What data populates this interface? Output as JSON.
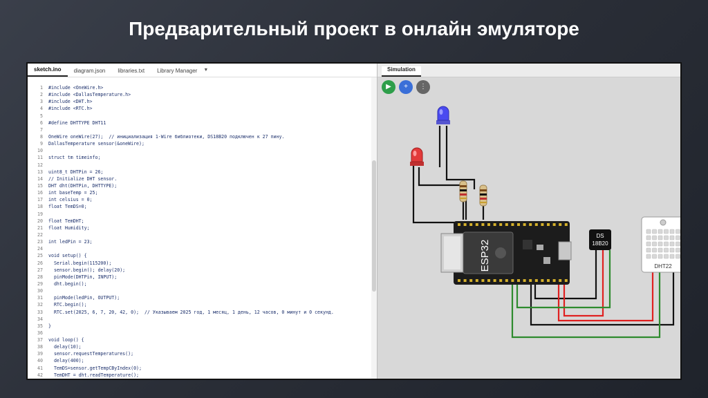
{
  "slide": {
    "title": "Предварительный проект в онлайн эмуляторе"
  },
  "editor": {
    "tabs": [
      {
        "label": "sketch.ino"
      },
      {
        "label": "diagram.json"
      },
      {
        "label": "libraries.txt"
      },
      {
        "label": "Library Manager"
      }
    ],
    "lines": [
      {
        "n": "1",
        "t": "#include <OneWire.h>"
      },
      {
        "n": "2",
        "t": "#include <DallasTemperature.h>"
      },
      {
        "n": "3",
        "t": "#include <DHT.h>"
      },
      {
        "n": "4",
        "t": "#include <RTC.h>"
      },
      {
        "n": "5",
        "t": ""
      },
      {
        "n": "6",
        "t": "#define DHTTYPE DHT11"
      },
      {
        "n": "7",
        "t": ""
      },
      {
        "n": "8",
        "t": "OneWire oneWire(27);  // инициализация 1-Wire библиотеки, DS18B20 подключен к 27 пину."
      },
      {
        "n": "9",
        "t": "DallasTemperature sensor(&oneWire);"
      },
      {
        "n": "10",
        "t": ""
      },
      {
        "n": "11",
        "t": "struct tm timeinfo;"
      },
      {
        "n": "12",
        "t": ""
      },
      {
        "n": "13",
        "t": "uint8_t DHTPin = 26;"
      },
      {
        "n": "14",
        "t": "// Initialize DHT sensor."
      },
      {
        "n": "15",
        "t": "DHT dht(DHTPin, DHTTYPE);"
      },
      {
        "n": "16",
        "t": "int baseTemp = 25;"
      },
      {
        "n": "17",
        "t": "int celsius = 0;"
      },
      {
        "n": "18",
        "t": "float TemDS=0;"
      },
      {
        "n": "19",
        "t": ""
      },
      {
        "n": "20",
        "t": "float TemDHT;"
      },
      {
        "n": "21",
        "t": "float Humidity;"
      },
      {
        "n": "22",
        "t": ""
      },
      {
        "n": "23",
        "t": "int ledPin = 23;"
      },
      {
        "n": "24",
        "t": ""
      },
      {
        "n": "25",
        "t": "void setup() {"
      },
      {
        "n": "26",
        "t": "  Serial.begin(115200);"
      },
      {
        "n": "27",
        "t": "  sensor.begin(); delay(20);"
      },
      {
        "n": "28",
        "t": "  pinMode(DHTPin, INPUT);"
      },
      {
        "n": "29",
        "t": "  dht.begin();"
      },
      {
        "n": "30",
        "t": ""
      },
      {
        "n": "31",
        "t": "  pinMode(ledPin, OUTPUT);"
      },
      {
        "n": "32",
        "t": "  RTC.begin();"
      },
      {
        "n": "33",
        "t": "  RTC.set(2025, 6, 7, 20, 42, 0);  // Указываем 2025 год, 1 месяц, 1 день, 12 часов, 0 минут и 0 секунд."
      },
      {
        "n": "34",
        "t": ""
      },
      {
        "n": "35",
        "t": "}"
      },
      {
        "n": "36",
        "t": ""
      },
      {
        "n": "37",
        "t": "void loop() {"
      },
      {
        "n": "38",
        "t": "  delay(10);"
      },
      {
        "n": "39",
        "t": "  sensor.requestTemperatures();"
      },
      {
        "n": "40",
        "t": "  delay(400);"
      },
      {
        "n": "41",
        "t": "  TemDS=sensor.getTempCByIndex(0);"
      },
      {
        "n": "42",
        "t": "  TemDHT = dht.readTemperature();"
      }
    ]
  },
  "simulation": {
    "tab": "Simulation",
    "buttons": {
      "run": "▶",
      "add": "+",
      "more": "⋮"
    },
    "board_label": "ESP32",
    "ds_label_1": "DS",
    "ds_label_2": "18B20",
    "dht_label": "DHT22",
    "colors": {
      "led_blue": "#4a4af0",
      "led_red": "#e23a3a",
      "wire_green": "#2e8b2e",
      "wire_red": "#e02020",
      "wire_black": "#111111"
    }
  }
}
